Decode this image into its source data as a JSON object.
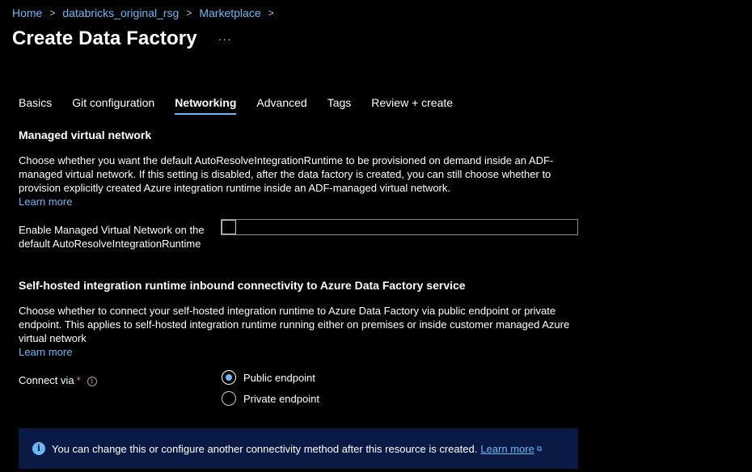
{
  "breadcrumb": {
    "items": [
      "Home",
      "databricks_original_rsg",
      "Marketplace"
    ],
    "separator": ">"
  },
  "header": {
    "title": "Create Data Factory",
    "more_label": "···"
  },
  "tabs": [
    {
      "label": "Basics",
      "active": false
    },
    {
      "label": "Git configuration",
      "active": false
    },
    {
      "label": "Networking",
      "active": true
    },
    {
      "label": "Advanced",
      "active": false
    },
    {
      "label": "Tags",
      "active": false
    },
    {
      "label": "Review + create",
      "active": false
    }
  ],
  "managed_vnet": {
    "heading": "Managed virtual network",
    "description": "Choose whether you want the default AutoResolveIntegrationRuntime to be provisioned on demand inside an ADF-managed virtual network. If this setting is disabled, after the data factory is created, you can still choose whether to provision explicitly created Azure integration runtime inside an ADF-managed virtual network.",
    "learn_more": "Learn more",
    "checkbox_label": "Enable Managed Virtual Network on the default AutoResolveIntegrationRuntime",
    "checkbox_checked": false
  },
  "self_hosted": {
    "heading": "Self-hosted integration runtime inbound connectivity to Azure Data Factory service",
    "description": "Choose whether to connect your self-hosted integration runtime to Azure Data Factory via public endpoint or private endpoint. This applies to self-hosted integration runtime running either on premises or inside customer managed Azure virtual network",
    "learn_more": "Learn more",
    "connect_via_label": "Connect via",
    "required_marker": "*",
    "options": [
      {
        "label": "Public endpoint",
        "selected": true
      },
      {
        "label": "Private endpoint",
        "selected": false
      }
    ]
  },
  "info_banner": {
    "text": "You can change this or configure another connectivity method after this resource is created.",
    "link": "Learn more"
  },
  "colors": {
    "accent": "#6cb8f6",
    "background": "#000000",
    "banner_bg": "#0a1a44",
    "required": "#f1707b"
  }
}
